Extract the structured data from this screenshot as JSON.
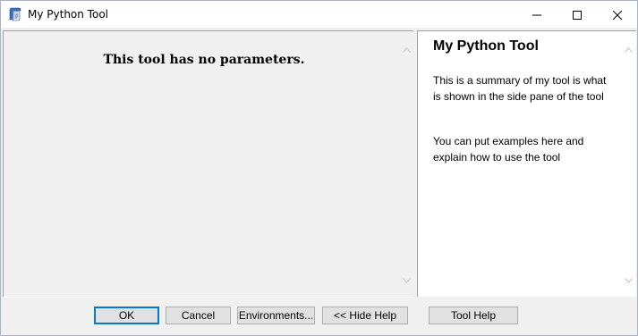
{
  "window": {
    "title": "My Python Tool",
    "controls": {
      "minimize_icon": "minimize-icon",
      "maximize_icon": "maximize-icon",
      "close_icon": "close-icon"
    }
  },
  "left_pane": {
    "message": "This tool has no parameters."
  },
  "help_pane": {
    "title": "My Python Tool",
    "paragraphs": [
      "This is a summary of my tool is what is shown in the side pane of the tool",
      "You can put examples here and explain how to use the tool"
    ]
  },
  "buttons": {
    "ok": "OK",
    "cancel": "Cancel",
    "environments": "Environments...",
    "hide_help": "<< Hide Help",
    "tool_help": "Tool Help"
  },
  "colors": {
    "accent": "#0078d7",
    "pane_background": "#f0f0f0",
    "help_background": "#ffffff"
  }
}
